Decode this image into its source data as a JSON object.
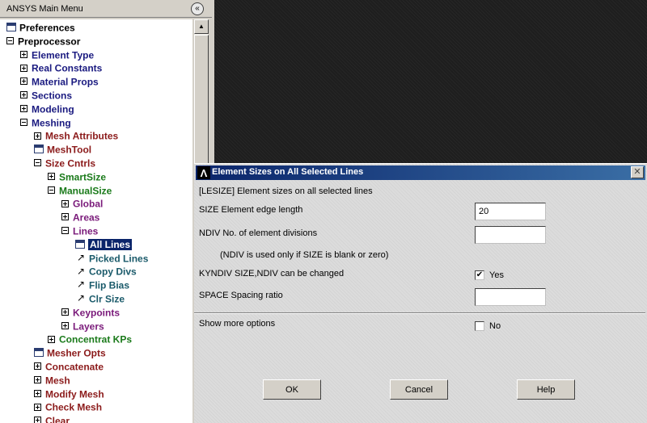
{
  "menu": {
    "title": "ANSYS Main Menu",
    "collapse_glyph": "«",
    "items": [
      {
        "label": "Preferences",
        "indent": 0,
        "icon": "window",
        "color": "#000000"
      },
      {
        "label": "Preprocessor",
        "indent": 0,
        "icon": "minus",
        "color": "#000000"
      },
      {
        "label": "Element Type",
        "indent": 1,
        "icon": "plus",
        "color": "#1a1a80"
      },
      {
        "label": "Real Constants",
        "indent": 1,
        "icon": "plus",
        "color": "#1a1a80"
      },
      {
        "label": "Material Props",
        "indent": 1,
        "icon": "plus",
        "color": "#1a1a80"
      },
      {
        "label": "Sections",
        "indent": 1,
        "icon": "plus",
        "color": "#1a1a80"
      },
      {
        "label": "Modeling",
        "indent": 1,
        "icon": "plus",
        "color": "#1a1a80"
      },
      {
        "label": "Meshing",
        "indent": 1,
        "icon": "minus",
        "color": "#1a1a80"
      },
      {
        "label": "Mesh Attributes",
        "indent": 2,
        "icon": "plus",
        "color": "#8b1a1a"
      },
      {
        "label": "MeshTool",
        "indent": 2,
        "icon": "window",
        "color": "#8b1a1a"
      },
      {
        "label": "Size Cntrls",
        "indent": 2,
        "icon": "minus",
        "color": "#8b1a1a"
      },
      {
        "label": "SmartSize",
        "indent": 3,
        "icon": "plus",
        "color": "#1a7a1a"
      },
      {
        "label": "ManualSize",
        "indent": 3,
        "icon": "minus",
        "color": "#1a7a1a"
      },
      {
        "label": "Global",
        "indent": 4,
        "icon": "plus",
        "color": "#7a1a7a"
      },
      {
        "label": "Areas",
        "indent": 4,
        "icon": "plus",
        "color": "#7a1a7a"
      },
      {
        "label": "Lines",
        "indent": 4,
        "icon": "minus",
        "color": "#7a1a7a"
      },
      {
        "label": "All Lines",
        "indent": 5,
        "icon": "window",
        "color": "#1a5a6a",
        "selected": true
      },
      {
        "label": "Picked Lines",
        "indent": 5,
        "icon": "arrow",
        "color": "#1a5a6a"
      },
      {
        "label": "Copy Divs",
        "indent": 5,
        "icon": "arrow",
        "color": "#1a5a6a"
      },
      {
        "label": "Flip Bias",
        "indent": 5,
        "icon": "arrow",
        "color": "#1a5a6a"
      },
      {
        "label": "Clr Size",
        "indent": 5,
        "icon": "arrow",
        "color": "#1a5a6a"
      },
      {
        "label": "Keypoints",
        "indent": 4,
        "icon": "plus",
        "color": "#7a1a7a"
      },
      {
        "label": "Layers",
        "indent": 4,
        "icon": "plus",
        "color": "#7a1a7a"
      },
      {
        "label": "Concentrat KPs",
        "indent": 3,
        "icon": "plus",
        "color": "#1a7a1a"
      },
      {
        "label": "Mesher Opts",
        "indent": 2,
        "icon": "window",
        "color": "#8b1a1a"
      },
      {
        "label": "Concatenate",
        "indent": 2,
        "icon": "plus",
        "color": "#8b1a1a"
      },
      {
        "label": "Mesh",
        "indent": 2,
        "icon": "plus",
        "color": "#8b1a1a"
      },
      {
        "label": "Modify Mesh",
        "indent": 2,
        "icon": "plus",
        "color": "#8b1a1a"
      },
      {
        "label": "Check Mesh",
        "indent": 2,
        "icon": "plus",
        "color": "#8b1a1a"
      },
      {
        "label": "Clear",
        "indent": 2,
        "icon": "plus",
        "color": "#8b1a1a"
      }
    ]
  },
  "dialog": {
    "title": "Element Sizes on All Selected Lines",
    "logo_glyph": "Λ",
    "close_glyph": "✕",
    "command": "[LESIZE]  Element sizes on all selected lines",
    "size_label": "SIZE   Element edge length",
    "size_value": "20",
    "ndiv_label": "NDIV    No. of element divisions",
    "ndiv_value": "",
    "ndiv_note": "(NDIV is used only if SIZE is blank or zero)",
    "kyndiv_label": "KYNDIV  SIZE,NDIV can be changed",
    "kyndiv_checked": true,
    "kyndiv_text": "Yes",
    "space_label": "SPACE   Spacing ratio",
    "space_value": "",
    "more_label": "Show more options",
    "more_checked": false,
    "more_text": "No",
    "check_glyph": "✔",
    "ok_label": "OK",
    "cancel_label": "Cancel",
    "help_label": "Help"
  }
}
